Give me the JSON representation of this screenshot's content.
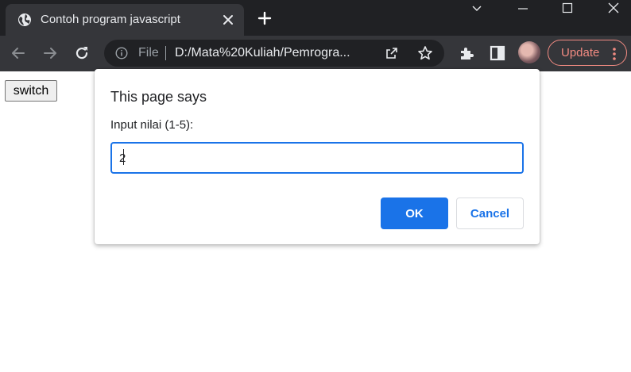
{
  "browser": {
    "tab": {
      "title": "Contoh program javascript",
      "favicon": "globe-icon"
    },
    "window_controls": [
      "chevron-down-icon",
      "minimize-icon",
      "maximize-icon",
      "close-icon"
    ],
    "toolbar": {
      "nav_icons": [
        "back-arrow-icon",
        "forward-arrow-icon",
        "reload-icon"
      ],
      "omnibox": {
        "scheme_label": "File",
        "url": "D:/Mata%20Kuliah/Pemrogra..."
      },
      "extension_icons": [
        "puzzle-icon",
        "side-panel-icon"
      ],
      "update_label": "Update"
    },
    "colors": {
      "titlebar": "#202124",
      "toolbar": "#35363a",
      "accent": "#1a73e8",
      "update": "#f28b82"
    }
  },
  "page": {
    "switch_button_label": "switch"
  },
  "dialog": {
    "title": "This page says",
    "message": "Input nilai (1-5):",
    "input_value": "2",
    "ok_label": "OK",
    "cancel_label": "Cancel"
  }
}
